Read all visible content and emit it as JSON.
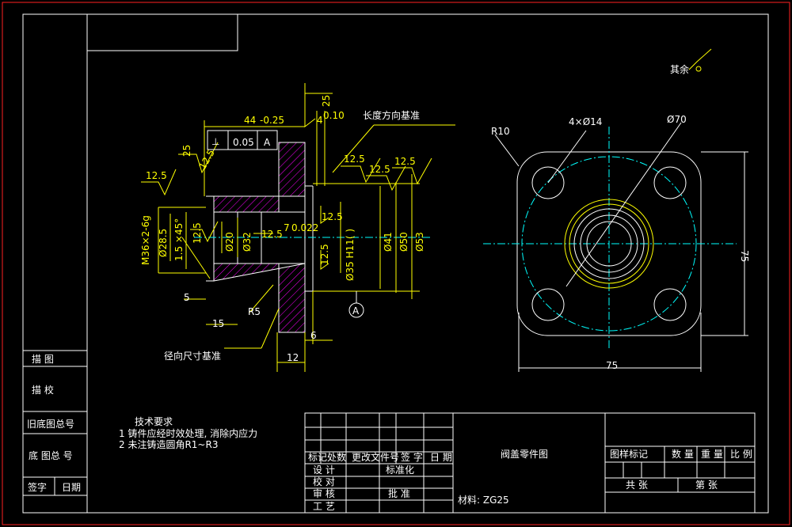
{
  "title": "阀盖零件图",
  "material": "材料: ZG25",
  "notes": {
    "heading": "技术要求",
    "items": [
      "1 铸件应经时效处理, 消除内应力",
      "2 未注铸造圆角R1~R3"
    ]
  },
  "labels": {
    "length_datum": "长度方向基准",
    "radial_datum": "径向尺寸基准",
    "remaining_roughness": "其余"
  },
  "dimensions": {
    "d44": "44",
    "d44_tol": "-0.25",
    "d4": "4",
    "d4_tol": "0.10",
    "d25": "25",
    "rough_12_5": "12.5",
    "flat_005": "0.05",
    "datum_a": "A",
    "m36": "M36×2-6g",
    "d28_5": "Ø28.5",
    "chamfer": "1.5 ×45°",
    "d20": "Ø20",
    "d32": "Ø32",
    "d7": "7",
    "d7_tol": "0.022",
    "d35": "Ø35 H11( )",
    "d41": "Ø41",
    "d50": "Ø50",
    "d53": "Ø53",
    "d5": "5",
    "d15": "15",
    "r5": "R5",
    "d6": "6",
    "d12": "12",
    "r10": "R10",
    "holes": "4×Ø14",
    "d70": "Ø70",
    "d75_h": "75",
    "d75_v": "75"
  },
  "left_block": {
    "rows": [
      "描 图",
      "描 校",
      "旧底图总号",
      "底 图总 号",
      "签字",
      "日期"
    ]
  },
  "title_block": {
    "revision_headers": [
      "标记",
      "处数",
      "更改文件号",
      "签 字",
      "日 期"
    ],
    "roles": [
      "设 计",
      "校 对",
      "审 核",
      "工 艺"
    ],
    "std": "标准化",
    "approve": "批 准",
    "right_headers": [
      "图样标记",
      "数 量",
      "重 量",
      "比 例"
    ],
    "sheet": [
      "共 张",
      "第 张"
    ]
  },
  "colors": {
    "lines": "#ffffff",
    "dimensions": "#ffff00",
    "centerlines": "#00ffff",
    "hatch": "#ff00ff",
    "frame": "#ff2222"
  }
}
